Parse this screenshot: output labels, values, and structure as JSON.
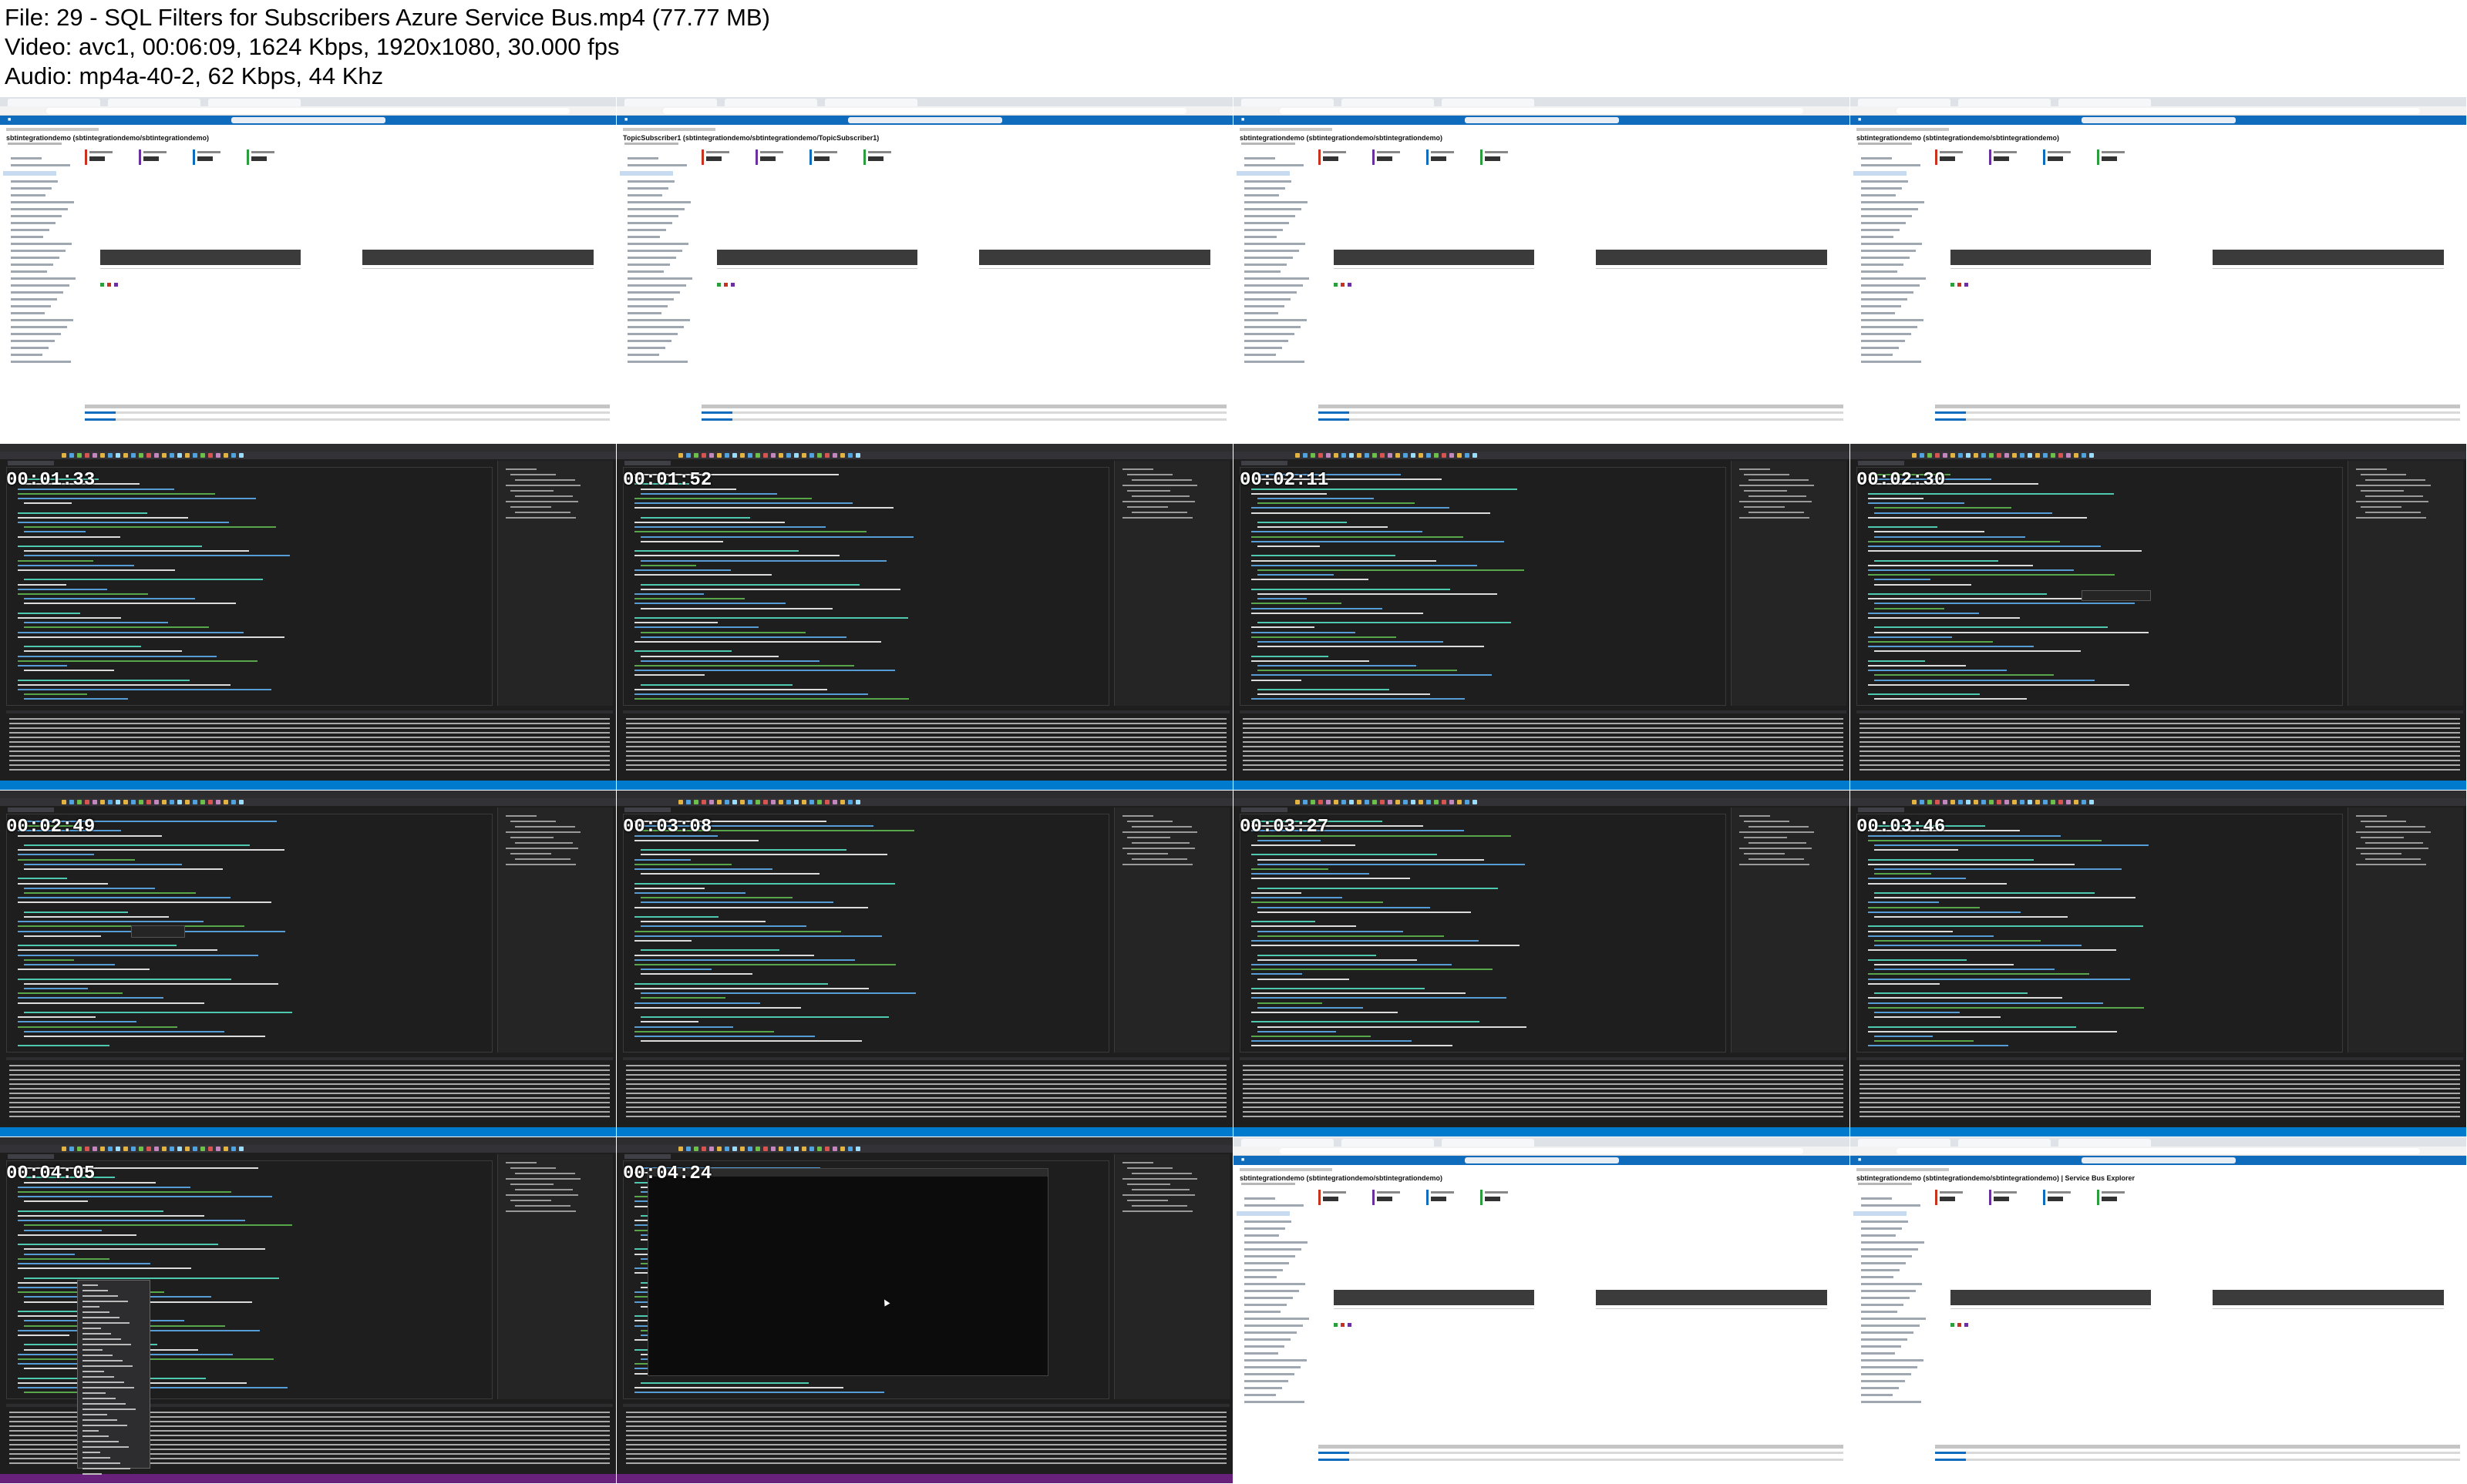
{
  "header": {
    "line1": "File: 29 - SQL Filters for Subscribers Azure Service Bus.mp4 (77.77 MB)",
    "line2": "Video: avc1, 00:06:09, 1624 Kbps, 1920x1080, 30.000 fps",
    "line3": "Audio: mp4a-40-2, 62 Kbps, 44 Khz"
  },
  "thumbnails": [
    {
      "kind": "azure",
      "title": "sbtintegrationdemo (sbtintegrationdemo/sbtintegrationdemo)",
      "timestamp": ""
    },
    {
      "kind": "azure",
      "title": "TopicSubscriber1 (sbtintegrationdemo/sbtintegrationdemo/TopicSubscriber1)",
      "timestamp": ""
    },
    {
      "kind": "azure",
      "title": "sbtintegrationdemo (sbtintegrationdemo/sbtintegrationdemo)",
      "timestamp": ""
    },
    {
      "kind": "azure",
      "title": "sbtintegrationdemo (sbtintegrationdemo/sbtintegrationdemo)",
      "timestamp": ""
    },
    {
      "kind": "vs",
      "timestamp": "00:01:33"
    },
    {
      "kind": "vs",
      "timestamp": "00:01:52"
    },
    {
      "kind": "vs",
      "timestamp": "00:02:11"
    },
    {
      "kind": "vs",
      "timestamp": "00:02:30"
    },
    {
      "kind": "vs",
      "timestamp": "00:02:49"
    },
    {
      "kind": "vs",
      "timestamp": "00:03:08"
    },
    {
      "kind": "vs",
      "timestamp": "00:03:27"
    },
    {
      "kind": "vs",
      "timestamp": "00:03:46"
    },
    {
      "kind": "vs",
      "timestamp": "00:04:05"
    },
    {
      "kind": "vs",
      "timestamp": "00:04:24"
    },
    {
      "kind": "azure",
      "title": "sbtintegrationdemo (sbtintegrationdemo/sbtintegrationdemo)",
      "timestamp": ""
    },
    {
      "kind": "azure",
      "title": "sbtintegrationdemo (sbtintegrationdemo/sbtintegrationdemo) | Service Bus Explorer",
      "timestamp": ""
    }
  ],
  "colors": {
    "azure_blue": "#0f6cbd",
    "vs_dark": "#1e1e1e",
    "vs_status": "#007acc",
    "code_green": "#57a64a",
    "code_blue": "#569cd6",
    "code_string": "#d69d85",
    "code_type": "#4ec9b0",
    "code_plain": "#dcdcdc"
  }
}
